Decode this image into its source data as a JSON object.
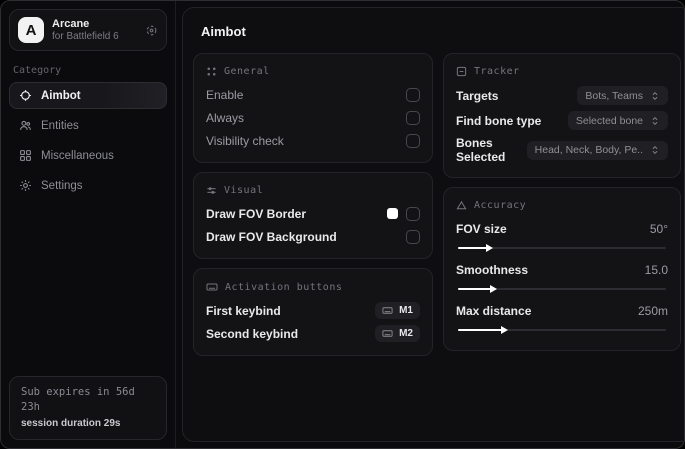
{
  "window": {
    "logo_letter": "A",
    "app_name": "Arcane",
    "app_subtitle": "for Battlefield 6"
  },
  "sidebar": {
    "category_label": "Category",
    "items": [
      {
        "label": "Aimbot",
        "icon": "crosshair-icon",
        "active": true
      },
      {
        "label": "Entities",
        "icon": "entities-icon",
        "active": false
      },
      {
        "label": "Miscellaneous",
        "icon": "grid-icon",
        "active": false
      },
      {
        "label": "Settings",
        "icon": "gear-icon",
        "active": false
      }
    ],
    "status": {
      "sub_expiry": "Sub expires in 56d 23h",
      "session_duration": "session duration 29s"
    }
  },
  "main": {
    "title": "Aimbot",
    "cards": {
      "general": {
        "title": "General",
        "rows": [
          {
            "label": "Enable",
            "checked": false
          },
          {
            "label": "Always",
            "checked": false
          },
          {
            "label": "Visibility check",
            "checked": false
          }
        ]
      },
      "visual": {
        "title": "Visual",
        "rows": [
          {
            "label": "Draw FOV Border",
            "swatch_color": "#ffffff",
            "checked": false
          },
          {
            "label": "Draw FOV Background",
            "checked": false
          }
        ]
      },
      "activation": {
        "title": "Activation buttons",
        "rows": [
          {
            "label": "First keybind",
            "key": "M1"
          },
          {
            "label": "Second keybind",
            "key": "M2"
          }
        ]
      },
      "tracker": {
        "title": "Tracker",
        "rows": [
          {
            "label": "Targets",
            "value": "Bots, Teams"
          },
          {
            "label": "Find bone type",
            "value": "Selected bone"
          },
          {
            "label": "Bones Selected",
            "value": "Head, Neck, Body, Pe.."
          }
        ]
      },
      "accuracy": {
        "title": "Accuracy",
        "sliders": [
          {
            "label": "FOV size",
            "value": "50°",
            "percent": 14
          },
          {
            "label": "Smoothness",
            "value": "15.0",
            "percent": 16
          },
          {
            "label": "Max distance",
            "value": "250m",
            "percent": 21
          }
        ]
      }
    }
  },
  "colors": {
    "accent_swatch": "#ffffff",
    "background": "#0b0b0d",
    "card_background": "#131316",
    "border": "#232328"
  }
}
